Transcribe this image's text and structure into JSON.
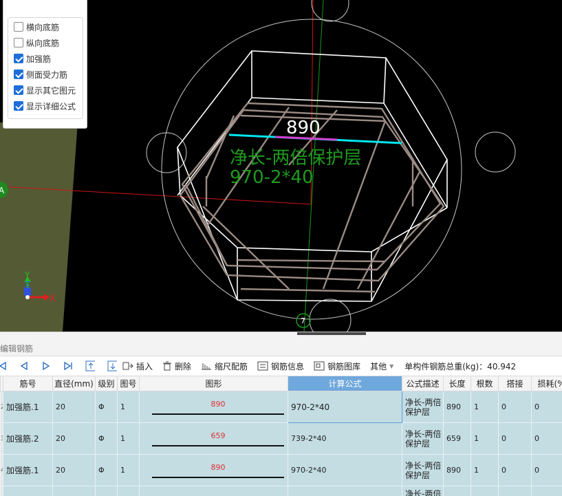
{
  "viewport": {
    "dimension_value": "890",
    "annotation_line1": "净长-两倍保护层",
    "annotation_line2": "970-2*40",
    "axis_label_a": "A",
    "axis_y": "Y",
    "axis_z": "Z",
    "axis_x": "X",
    "marker_label": "7",
    "colors": {
      "background": "#000000",
      "rebar": "#9b8b84",
      "dimension": "#00e5ee",
      "annotation": "#1f9a1f"
    }
  },
  "layer_panel": {
    "items": [
      {
        "label": "横向底筋",
        "checked": false
      },
      {
        "label": "纵向底筋",
        "checked": false
      },
      {
        "label": "加强筋",
        "checked": true
      },
      {
        "label": "侧面受力筋",
        "checked": true
      },
      {
        "label": "显示其它图元",
        "checked": true
      },
      {
        "label": "显示详细公式",
        "checked": true
      }
    ]
  },
  "editor": {
    "title": "编辑钢筋",
    "toolbar": {
      "insert": "插入",
      "delete": "删除",
      "scale_rebar": "缩尺配筋",
      "rebar_info": "钢筋信息",
      "rebar_library": "钢筋图库",
      "other": "其他",
      "total_weight": "单构件钢筋总重(kg)：40.942"
    },
    "columns": [
      "筋号",
      "直径(mm)",
      "级别",
      "图号",
      "图形",
      "计算公式",
      "公式描述",
      "长度",
      "根数",
      "搭接",
      "损耗(%"
    ],
    "rows": [
      {
        "row": "2",
        "name": "加强筋.1",
        "diameter": "20",
        "grade": "Φ",
        "figure_no": "1",
        "shape_len": "890",
        "formula": "970-2*40",
        "desc": "净长-两倍保护层",
        "length": "890",
        "count": "1",
        "lap": "0",
        "loss": "0"
      },
      {
        "row": "3",
        "name": "加强筋.2",
        "diameter": "20",
        "grade": "Φ",
        "figure_no": "1",
        "shape_len": "659",
        "formula": "739-2*40",
        "desc": "净长-两倍保护层",
        "length": "659",
        "count": "1",
        "lap": "0",
        "loss": "0"
      },
      {
        "row": "4",
        "name": "加强筋.1",
        "diameter": "20",
        "grade": "Φ",
        "figure_no": "1",
        "shape_len": "890",
        "formula": "970-2*40",
        "desc": "净长-两倍保护层",
        "length": "890",
        "count": "1",
        "lap": "0",
        "loss": "0"
      },
      {
        "row": "",
        "name": "",
        "diameter": "",
        "grade": "",
        "figure_no": "",
        "shape_len": "",
        "formula": "",
        "desc": "净长-两倍",
        "length": "",
        "count": "",
        "lap": "",
        "loss": ""
      }
    ]
  }
}
